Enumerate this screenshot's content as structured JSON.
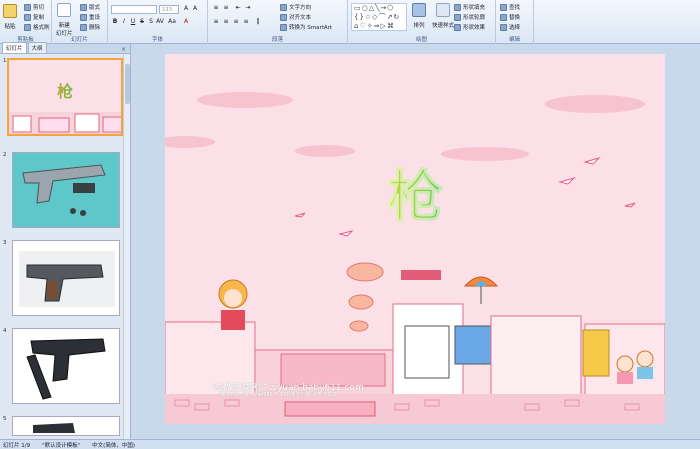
{
  "ribbon": {
    "clipboard": {
      "paste": "粘贴",
      "cut": "剪切",
      "copy": "复制",
      "format_painter": "格式刷",
      "label": "剪贴板"
    },
    "slides": {
      "new_slide": "新建\n幻灯片",
      "layout": "版式",
      "reset": "重设",
      "delete": "删除",
      "label": "幻灯片"
    },
    "font": {
      "font_size": "115",
      "label": "字体"
    },
    "paragraph": {
      "text_direction": "文字方向",
      "align_text": "对齐文本",
      "smartart": "转换为 SmartArt",
      "label": "段落"
    },
    "drawing": {
      "arrange": "排列",
      "quick_styles": "快速样式",
      "shape_fill": "形状填充",
      "shape_outline": "形状轮廓",
      "shape_effects": "形状效果",
      "label": "绘图"
    },
    "editing": {
      "find": "查找",
      "replace": "替换",
      "select": "选择",
      "label": "编辑"
    }
  },
  "panel": {
    "tabs": [
      "幻灯片",
      "大纲"
    ],
    "close": "×",
    "slide_numbers": [
      "1",
      "2",
      "3",
      "4",
      "5"
    ]
  },
  "slide": {
    "title": "枪",
    "site_name": "幼教资源网站  ziyuan.baby611.com",
    "site_sub": "课件下载  儿歌  故事MP3  FLASH课件下载  试卷下载库"
  },
  "statusbar": {
    "slide_index": "幻灯片 1/9",
    "theme": "\"默认设计模板\"",
    "language": "中文(简体，中国)"
  },
  "colors": {
    "ribbon_bg": "#dbe7f5",
    "slide_bg": "#fbe1e7",
    "selection": "#f6a33a"
  }
}
